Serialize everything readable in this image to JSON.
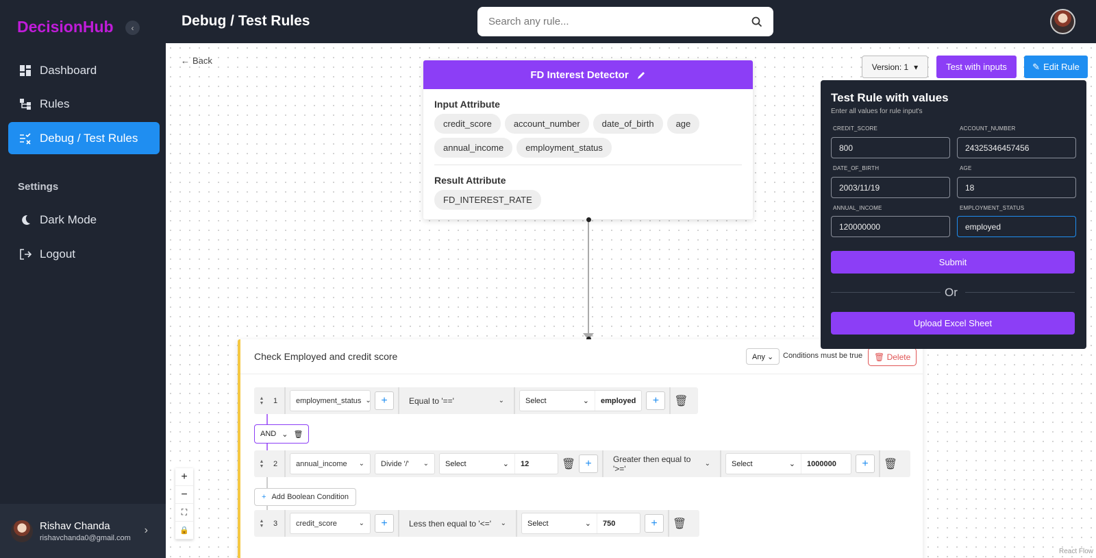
{
  "app": {
    "name": "DecisionHub",
    "collapse_glyph": "‹"
  },
  "sidebar": {
    "items": [
      {
        "label": "Dashboard",
        "icon": "dashboard-icon"
      },
      {
        "label": "Rules",
        "icon": "rules-icon"
      },
      {
        "label": "Debug / Test Rules",
        "icon": "debug-icon",
        "active": true
      }
    ],
    "settings_label": "Settings",
    "settings_items": [
      {
        "label": "Dark Mode",
        "icon": "moon-icon"
      },
      {
        "label": "Logout",
        "icon": "logout-icon"
      }
    ],
    "user": {
      "name": "Rishav Chanda",
      "email": "rishavchanda0@gmail.com"
    }
  },
  "header": {
    "title": "Debug / Test Rules",
    "search_placeholder": "Search any rule..."
  },
  "canvas": {
    "back_label": "Back",
    "version_label": "Version: 1",
    "test_button": "Test with inputs",
    "edit_button": "Edit Rule",
    "react_flow_label": "React Flow"
  },
  "rule_card": {
    "title": "FD Interest Detector",
    "input_title": "Input Attribute",
    "inputs": [
      "credit_score",
      "account_number",
      "date_of_birth",
      "age",
      "annual_income",
      "employment_status"
    ],
    "result_title": "Result Attribute",
    "results": [
      "FD_INTEREST_RATE"
    ]
  },
  "condition": {
    "title": "Check Employed and credit score",
    "any_label": "Any",
    "hint": "Conditions must be true",
    "delete_label": "Delete",
    "and_label": "AND",
    "add_boolean": "Add Boolean Condition",
    "rows": [
      {
        "num": "1",
        "attribute": "employment_status",
        "operator": "Equal to '=='",
        "select": "Select",
        "value": "employed"
      },
      {
        "num": "2",
        "attribute": "annual_income",
        "math_op": "Divide '/'",
        "math_select": "Select",
        "math_value": "12",
        "operator": "Greater then equal to '>='",
        "select": "Select",
        "value": "1000000"
      },
      {
        "num": "3",
        "attribute": "credit_score",
        "operator": "Less then equal to '<='",
        "select": "Select",
        "value": "750"
      }
    ]
  },
  "test_panel": {
    "title": "Test Rule with values",
    "subtitle": "Enter all values for rule input's",
    "fields": [
      {
        "label": "CREDIT_SCORE",
        "value": "800"
      },
      {
        "label": "ACCOUNT_NUMBER",
        "value": "24325346457456"
      },
      {
        "label": "DATE_OF_BIRTH",
        "value": "2003/11/19"
      },
      {
        "label": "AGE",
        "value": "18"
      },
      {
        "label": "ANNUAL_INCOME",
        "value": "120000000"
      },
      {
        "label": "EMPLOYMENT_STATUS",
        "value": "employed"
      }
    ],
    "submit": "Submit",
    "or": "Or",
    "upload": "Upload Excel Sheet"
  },
  "colors": {
    "primary_purple": "#8c3ef6",
    "accent_blue": "#1f8ef1",
    "dark_bg": "#1f2531",
    "logo": "#c01cd9"
  }
}
